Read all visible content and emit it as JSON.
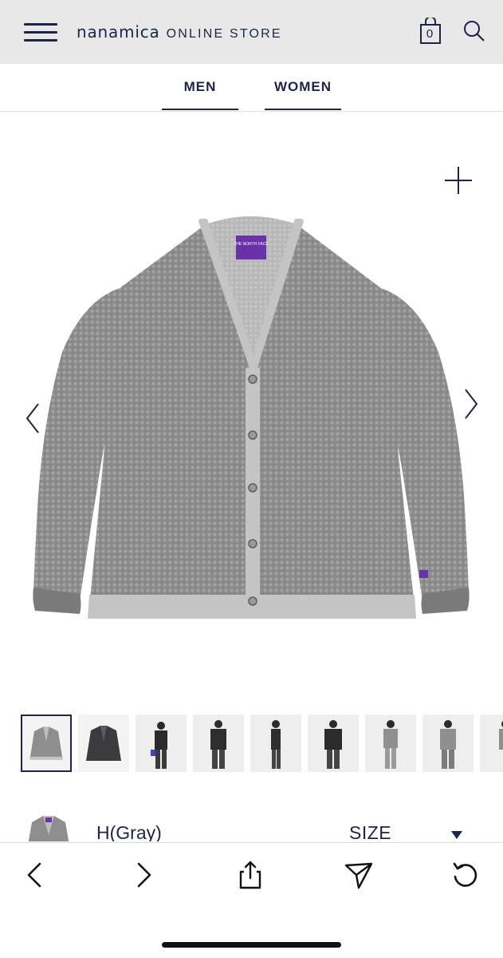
{
  "header": {
    "brand_logo": "nanamica",
    "brand_suffix": "ONLINE STORE",
    "cart_count": "0",
    "icons": [
      "menu-icon",
      "shopping-bag-icon",
      "search-icon"
    ]
  },
  "tabs": [
    {
      "label": "MEN"
    },
    {
      "label": "WOMEN"
    }
  ],
  "product": {
    "color": "H(Gray)",
    "size_label": "SIZE",
    "label_brand_text": "THE NORTH FACE"
  },
  "gallery": {
    "thumbnail_count": 9,
    "selected_index": 0,
    "icons": [
      "zoom-plus-icon",
      "chevron-left-icon",
      "chevron-right-icon"
    ]
  },
  "colors": {
    "header_bg": "#e8e8e8",
    "navy": "#1e2447",
    "garment_gray": "#8e8e8e",
    "label_purple": "#6a32a8"
  },
  "toolbar": {
    "icons": [
      "back-icon",
      "forward-icon",
      "share-icon",
      "send-icon",
      "reload-icon"
    ]
  }
}
